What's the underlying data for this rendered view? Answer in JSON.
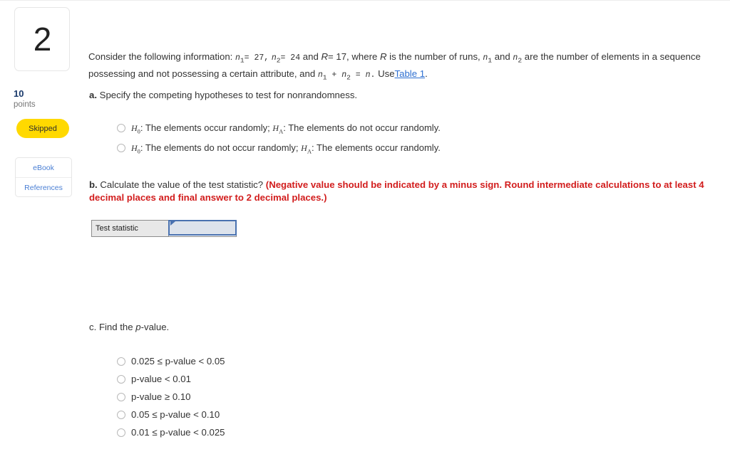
{
  "sidebar": {
    "question_number": "2",
    "points_value": "10",
    "points_label": "points",
    "status_badge": "Skipped",
    "ebook_label": "eBook",
    "references_label": "References"
  },
  "prompt": {
    "lead": "Consider the following information:",
    "eq_n1": "n1",
    "eq_n1_val": "= 27,",
    "eq_n2": "n2",
    "eq_n2_val": "= 24",
    "and_1": "and",
    "eq_R": "R",
    "eq_R_val": "= 17,",
    "mid_1": "where",
    "var_R": "R",
    "mid_2": "is the number of runs,",
    "var_n1": "n1",
    "mid_3": "and",
    "var_n2": "n2",
    "mid_4": "are the number of elements in a sequence possessing and not possessing a certain attribute, and",
    "eq_sum": "n1 + n2 = n.",
    "use_label": "Use",
    "link_label": "Table 1",
    "period": "."
  },
  "part_a": {
    "marker": "a.",
    "text": "Specify the competing hypotheses to test for nonrandomness.",
    "options": [
      {
        "h0_sym": "H",
        "h0_sub": "0",
        "h0_text": ": The elements occur randomly;",
        "ha_sym": "H",
        "ha_sub": "A",
        "ha_text": ": The elements do not occur randomly."
      },
      {
        "h0_sym": "H",
        "h0_sub": "0",
        "h0_text": ": The elements do not occur randomly;",
        "ha_sym": "H",
        "ha_sub": "A",
        "ha_text": ": The elements occur randomly."
      }
    ]
  },
  "part_b": {
    "marker": "b.",
    "text": "Calculate the value of the test statistic?",
    "note": "(Negative value should be indicated by a minus sign. Round intermediate calculations to at least 4 decimal places and final answer to 2 decimal places.)",
    "answer_row_label": "Test statistic",
    "answer_value": ""
  },
  "part_c": {
    "marker": "c.",
    "text_pre": "Find the",
    "text_ital": "p",
    "text_post": "-value.",
    "options": [
      "0.025 ≤ p-value < 0.05",
      "p-value < 0.01",
      "p-value ≥ 0.10",
      "0.05 ≤ p-value < 0.10",
      "0.01 ≤ p-value < 0.025"
    ]
  },
  "colors": {
    "badge_yellow": "#ffd900",
    "note_red": "#d21d1d",
    "link_blue": "#2d6fd1",
    "points_navy": "#1a3a6b",
    "input_border": "#4a72b0",
    "input_fill": "#dde3ec"
  }
}
